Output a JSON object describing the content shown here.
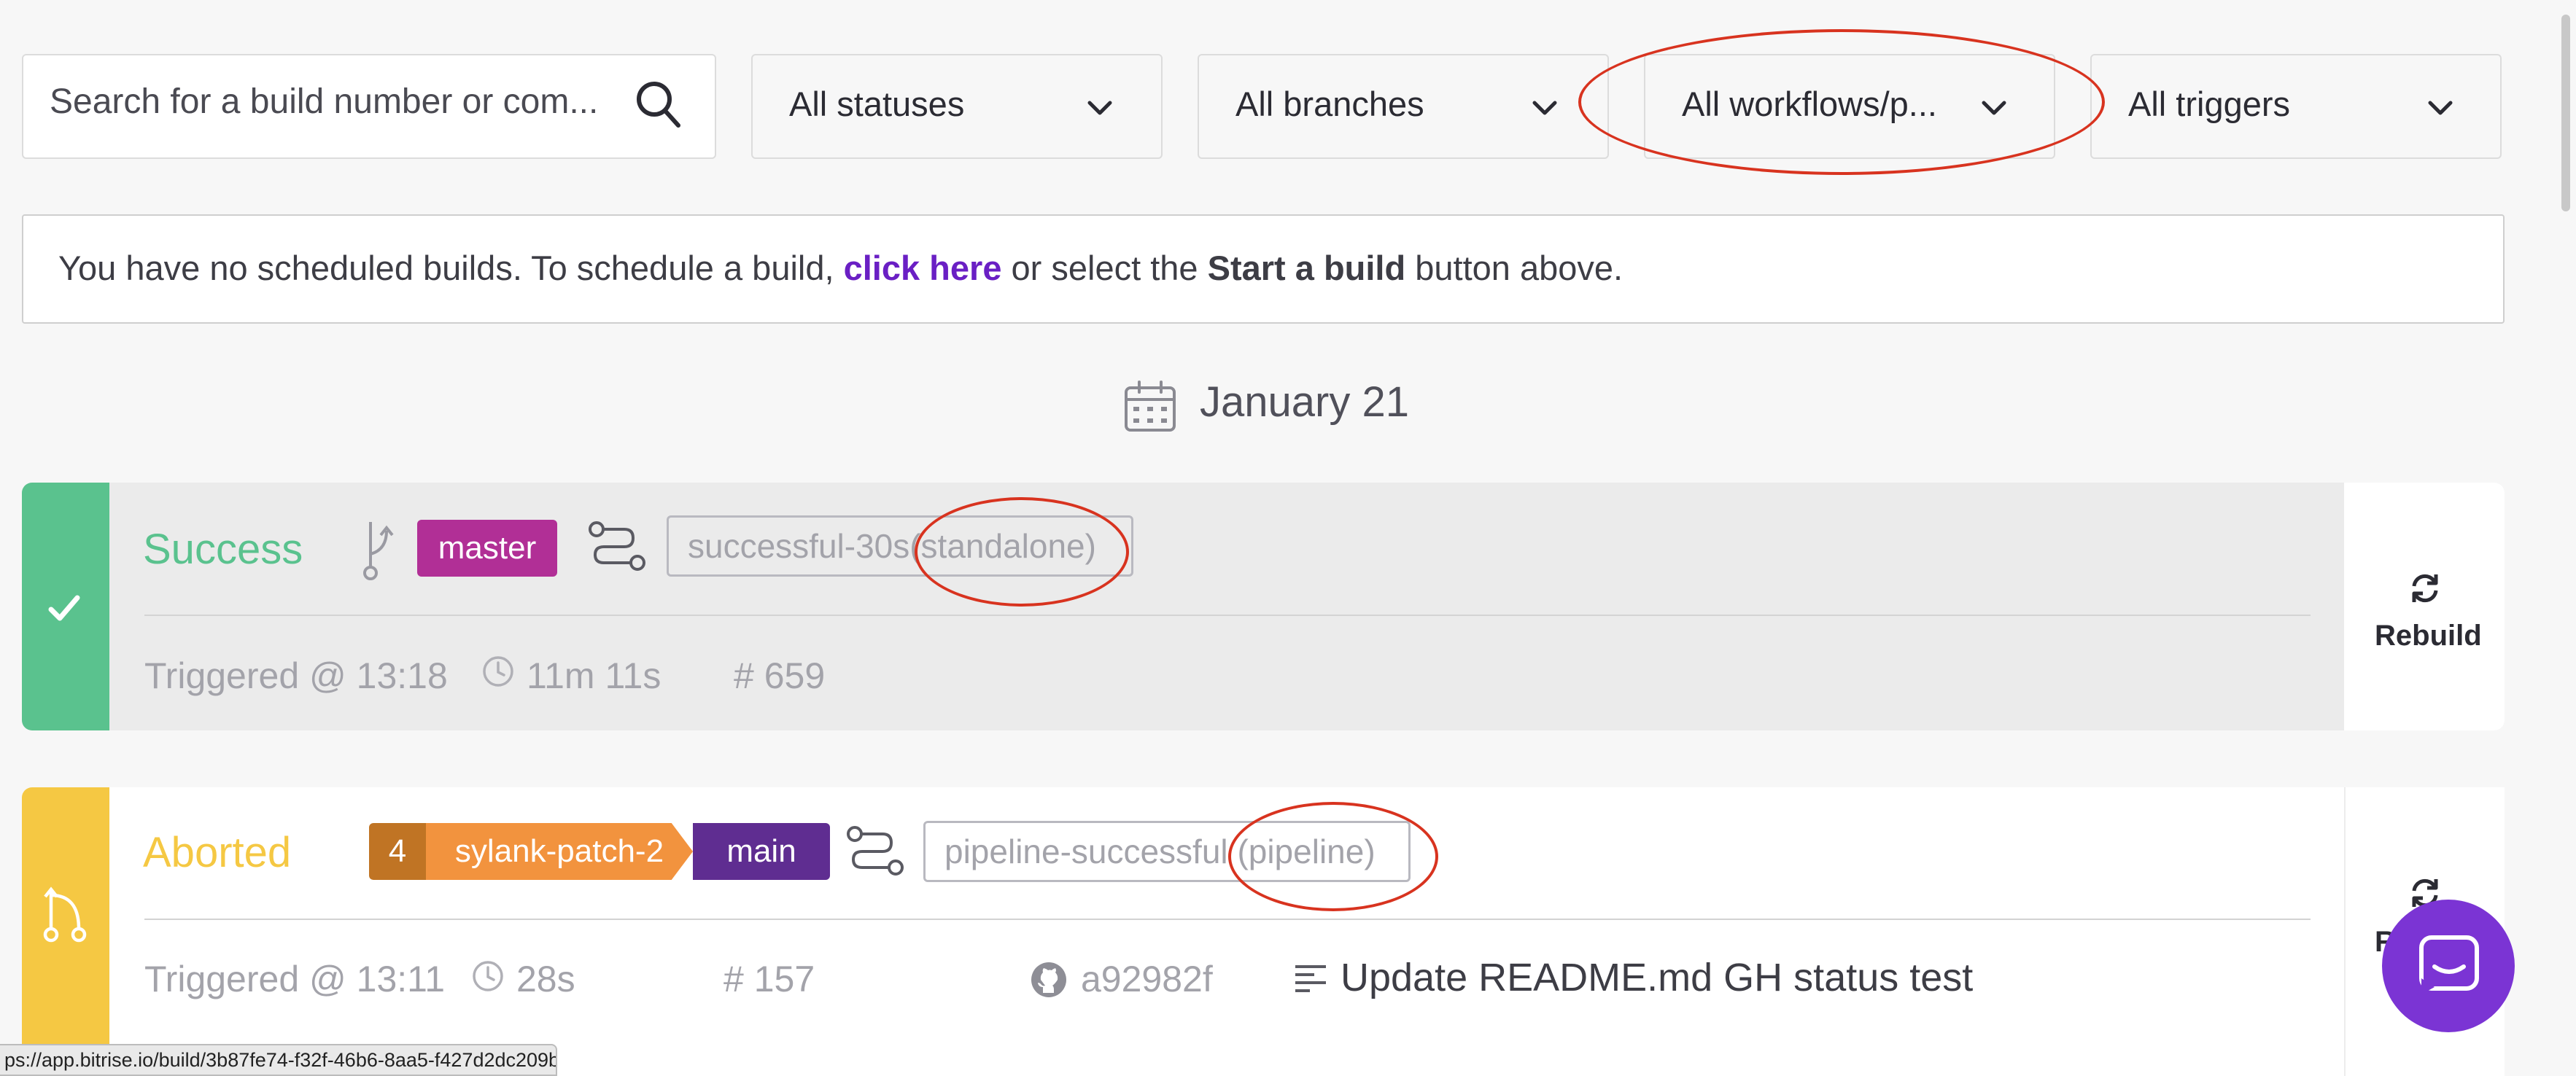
{
  "filters": {
    "search_placeholder": "Search for a build number or com...",
    "status": "All statuses",
    "branch": "All branches",
    "workflow": "All workflows/p...",
    "trigger": "All triggers"
  },
  "banner": {
    "text_before": "You have no scheduled builds. To schedule a build, ",
    "link": "click here",
    "text_middle": " or select the ",
    "bold": "Start a build",
    "text_after": " button above."
  },
  "date_header": "January 21",
  "builds": [
    {
      "status": "Success",
      "status_color": "#5ac28e",
      "branch": "master",
      "branch_color": "#b12f96",
      "workflow": "successful-30s",
      "workflow_type": "(standalone)",
      "triggered": "Triggered @ 13:18",
      "duration": "11m 11s",
      "number": "# 659",
      "action": "Rebuild"
    },
    {
      "status": "Aborted",
      "status_color": "#f5c843",
      "pr_number": "4",
      "source_branch": "sylank-patch-2",
      "target_branch": "main",
      "workflow": "pipeline-successful",
      "workflow_type": "(pipeline)",
      "triggered": "Triggered @ 13:11",
      "duration": "28s",
      "number": "# 157",
      "commit_hash": "a92982f",
      "commit_message": "Update README.md GH status test",
      "action": "R"
    }
  ],
  "status_url": "ps://app.bitrise.io/build/3b87fe74-f32f-46b6-8aa5-f427d2dc209b"
}
